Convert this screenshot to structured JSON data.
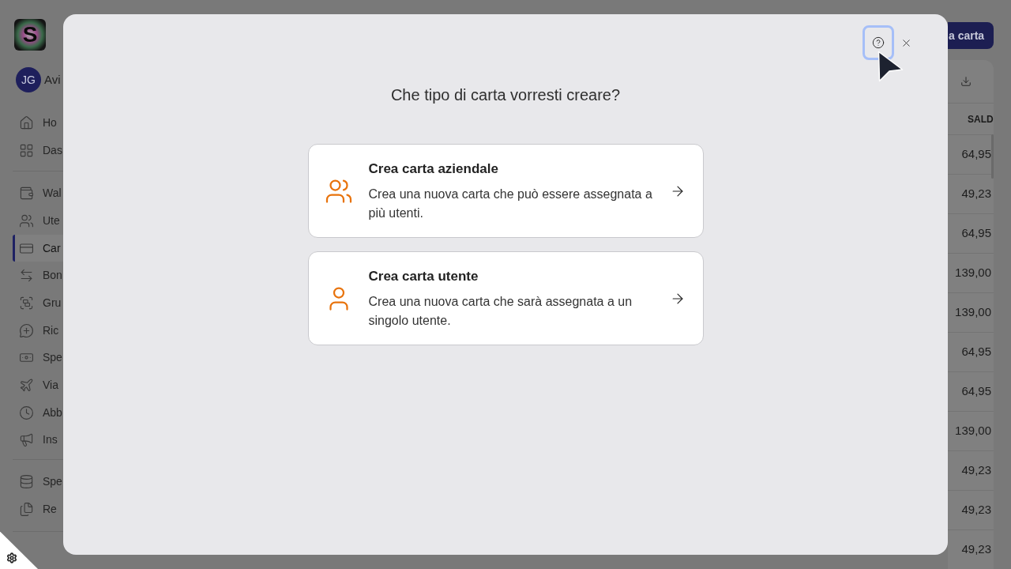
{
  "sidebar": {
    "logo": {
      "letter": "S"
    },
    "user": {
      "initials": "JG",
      "name": "Avi"
    },
    "groups": [
      {
        "items": [
          {
            "label": "Ho",
            "selected": false
          },
          {
            "label": "Das",
            "selected": false
          }
        ]
      },
      {
        "items": [
          {
            "label": "Wal",
            "selected": false
          },
          {
            "label": "Ute",
            "selected": false
          },
          {
            "label": "Car",
            "selected": true
          },
          {
            "label": "Bon",
            "selected": false
          },
          {
            "label": "Gru",
            "selected": false
          },
          {
            "label": "Ric",
            "selected": false
          },
          {
            "label": "Spe",
            "selected": false
          },
          {
            "label": "Via",
            "selected": false
          },
          {
            "label": "Abb",
            "selected": false
          },
          {
            "label": "Ins",
            "selected": false
          }
        ]
      },
      {
        "items": [
          {
            "label": "Spe",
            "selected": false
          },
          {
            "label": "Re",
            "selected": false
          }
        ]
      }
    ]
  },
  "header": {
    "primary_button": "a carta"
  },
  "table": {
    "columns": [
      "SALD"
    ],
    "rows": [
      [
        "64,95"
      ],
      [
        "49,23"
      ],
      [
        "64,95"
      ],
      [
        "139,00"
      ],
      [
        "139,00"
      ],
      [
        "64,95"
      ],
      [
        "64,95"
      ],
      [
        "139,00"
      ],
      [
        "49,23"
      ],
      [
        "49,23"
      ],
      [
        "49,23"
      ]
    ]
  },
  "modal": {
    "help_button": {
      "focused": true
    },
    "title": "Che tipo di carta vorresti creare?",
    "options": [
      {
        "title": "Crea carta aziendale",
        "description": "Crea una nuova carta che può essere assegnata a più utenti."
      },
      {
        "title": "Crea carta utente",
        "description": "Crea una nuova carta che sarà assegnata a un singolo utente."
      }
    ]
  }
}
